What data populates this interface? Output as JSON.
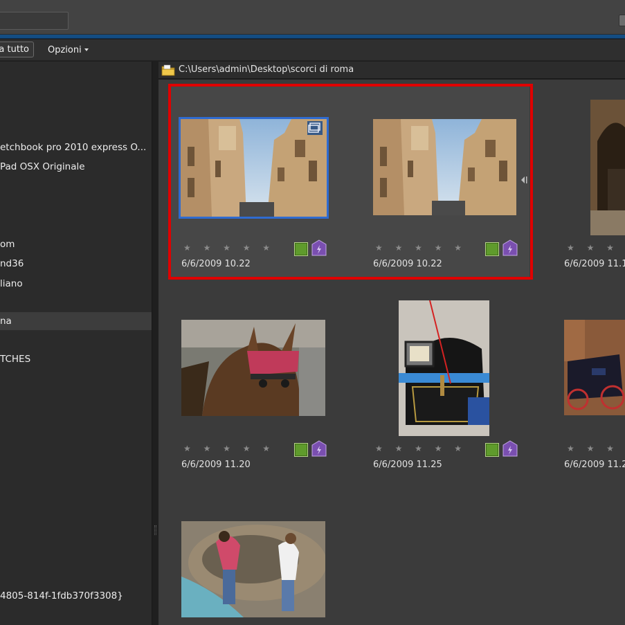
{
  "toolbar": {
    "select_all_label": "a tutto",
    "options_label": "Opzioni"
  },
  "sidebar": {
    "items": [
      {
        "label": "etchbook pro 2010 express O...",
        "selected": false
      },
      {
        "label": "Pad  OSX Originale",
        "selected": false
      },
      {
        "label": "om",
        "selected": false
      },
      {
        "label": "nd36",
        "selected": false
      },
      {
        "label": "liano",
        "selected": false
      },
      {
        "label": "na",
        "selected": true
      },
      {
        "label": "TCHES",
        "selected": false
      },
      {
        "label": "4805-814f-1fdb370f3308}",
        "selected": false
      }
    ]
  },
  "path": {
    "text": "C:\\Users\\admin\\Desktop\\scorci di roma",
    "icon": "folder-icon"
  },
  "thumbnails": [
    {
      "date": "6/6/2009 10.22",
      "rating": 0,
      "subject": "street-buildings",
      "selected": true,
      "stack": true
    },
    {
      "date": "6/6/2009 10.22",
      "rating": 0,
      "subject": "street-buildings",
      "selected": false
    },
    {
      "date": "6/6/2009 11.1",
      "rating": 0,
      "subject": "archway"
    },
    {
      "date": "6/6/2009 11.20",
      "rating": 0,
      "subject": "horse"
    },
    {
      "date": "6/6/2009 11.25",
      "rating": 0,
      "subject": "carriage-lamp"
    },
    {
      "date": "6/6/2009 11.2",
      "rating": 0,
      "subject": "carriage"
    },
    {
      "subject": "fountain-girls"
    }
  ],
  "stars_glyph": "★ ★ ★ ★ ★",
  "colors": {
    "selection_frame": "#e00000",
    "selected_thumb_border": "#2f6bd0",
    "accent_strip": "#144d83",
    "green_badge": "#5f9b2c",
    "purple_tag": "#7a4fb0"
  }
}
